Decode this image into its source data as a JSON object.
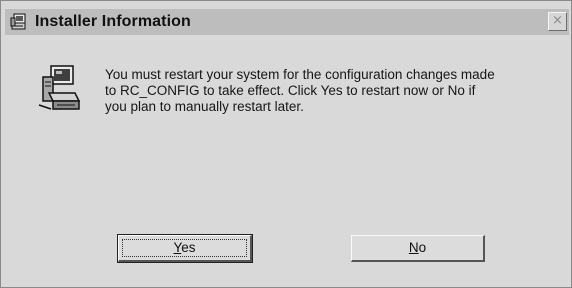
{
  "dialog": {
    "title": "Installer Information",
    "title_icon": "installer-setup-icon",
    "close_glyph": "×",
    "message_icon": "installer-setup-icon",
    "message": "You must restart your system for the configuration changes made\nto RC_CONFIG to take effect. Click Yes to restart now or No if\nyou plan to manually restart later."
  },
  "buttons": {
    "yes_label": "Yes",
    "no_label": "No",
    "default": "yes"
  },
  "colors": {
    "window_bg": "#d9d9d9",
    "titlebar_bg": "#bdbdbd",
    "text": "#111111"
  }
}
